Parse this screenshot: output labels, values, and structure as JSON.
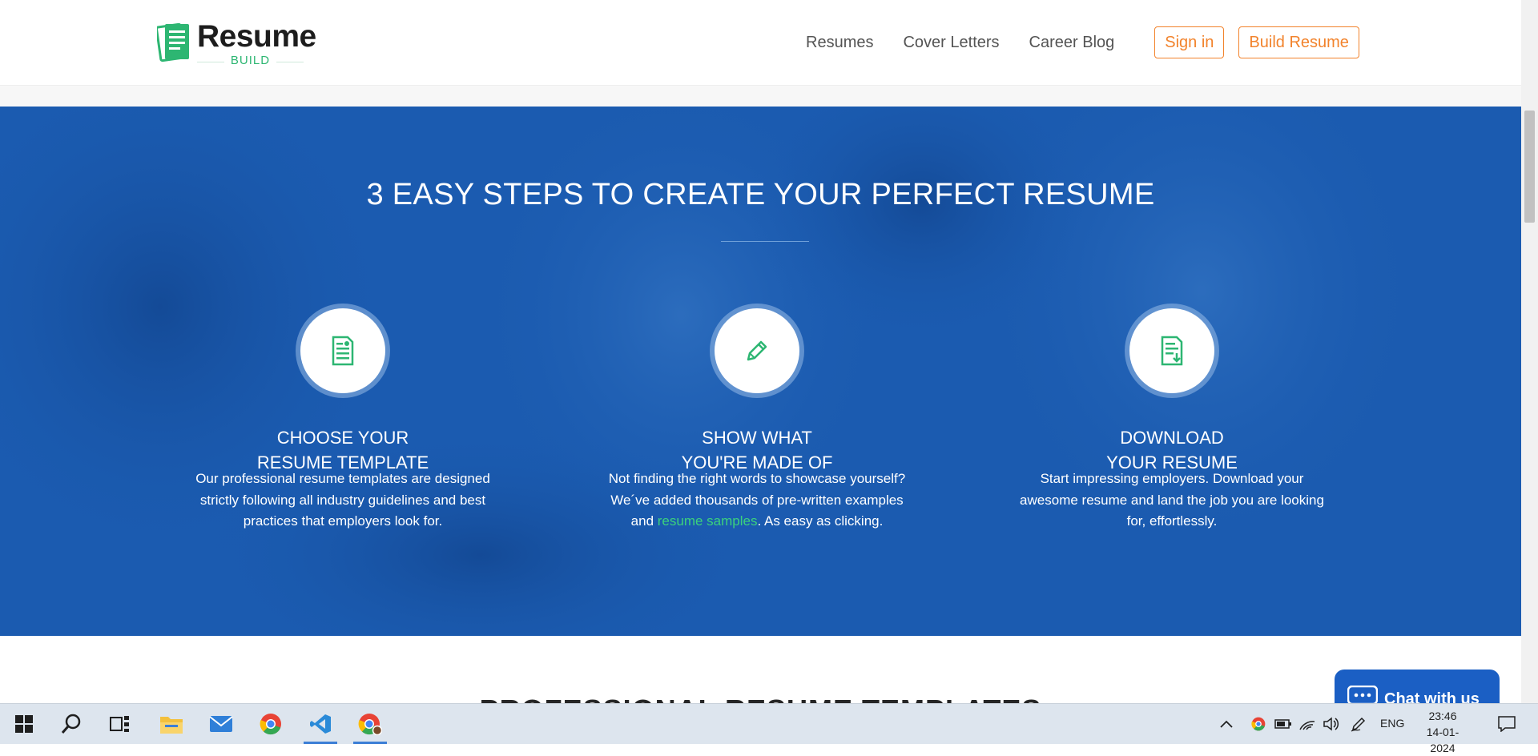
{
  "header": {
    "logo": {
      "word": "Resume",
      "sub": "BUILD"
    },
    "nav": [
      {
        "label": "Resumes"
      },
      {
        "label": "Cover Letters"
      },
      {
        "label": "Career Blog"
      }
    ],
    "sign_in_label": "Sign in",
    "build_label": "Build Resume"
  },
  "hero": {
    "title": "3 EASY STEPS TO CREATE YOUR PERFECT RESUME",
    "steps": [
      {
        "icon": "resume-document-icon",
        "title_line1": "CHOOSE YOUR",
        "title_line2": "RESUME TEMPLATE",
        "text": "Our professional resume templates are designed strictly following all industry guidelines and best practices that employers look for."
      },
      {
        "icon": "pencil-icon",
        "title_line1": "SHOW WHAT",
        "title_line2": "YOU'RE MADE OF",
        "text_before": "Not finding the right words to showcase yourself? We´ve added thousands of pre-written examples and ",
        "link": "resume samples",
        "text_after": ". As easy as clicking."
      },
      {
        "icon": "download-document-icon",
        "title_line1": "DOWNLOAD",
        "title_line2": "YOUR RESUME",
        "text": "Start impressing employers. Download your awesome resume and land the job you are looking for, effortlessly."
      }
    ]
  },
  "next_section": {
    "heading": "PROFESSIONAL RESUME TEMPLATES"
  },
  "chat": {
    "label": "Chat with us"
  },
  "taskbar": {
    "apps": [
      "windows-start-icon",
      "search-icon",
      "task-view-icon",
      "file-explorer-icon",
      "mail-icon",
      "chrome-icon",
      "vscode-icon",
      "chrome-profile-icon"
    ],
    "tray": {
      "language": "ENG",
      "time": "23:46",
      "date": "14-01-2024"
    }
  },
  "colors": {
    "brand_green": "#2db672",
    "accent_orange": "#f2832c",
    "hero_blue": "#1b5bb0",
    "link_green": "#3bd27c"
  }
}
